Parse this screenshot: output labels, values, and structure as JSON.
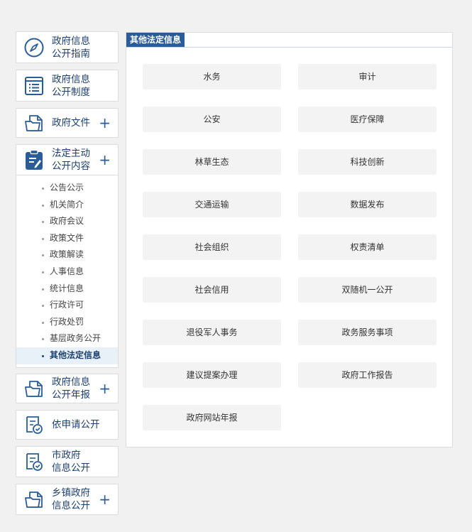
{
  "sidebar": {
    "items": [
      {
        "label": "政府信息\n公开指南",
        "icon": "compass-icon"
      },
      {
        "label": "政府信息\n公开制度",
        "icon": "document-list-icon"
      },
      {
        "label": "政府文件",
        "icon": "folder-icon",
        "plus": "+"
      },
      {
        "label": "法定主动\n公开内容",
        "icon": "clipboard-edit-icon",
        "plus": "+"
      },
      {
        "label": "政府信息\n公开年报",
        "icon": "folder-icon",
        "plus": "+"
      },
      {
        "label": "依申请公开",
        "icon": "certificate-check-icon"
      },
      {
        "label": "市政府\n信息公开",
        "icon": "certificate-check-icon"
      },
      {
        "label": "乡镇政府\n信息公开",
        "icon": "folder-icon",
        "plus": "+"
      }
    ],
    "submenu": [
      "公告公示",
      "机关简介",
      "政府会议",
      "政策文件",
      "政策解读",
      "人事信息",
      "统计信息",
      "行政许可",
      "行政处罚",
      "基层政务公开",
      "其他法定信息"
    ],
    "active_submenu": "其他法定信息"
  },
  "content": {
    "tab_title": "其他法定信息",
    "buttons": [
      "水务",
      "审计",
      "公安",
      "医疗保障",
      "林草生态",
      "科技创新",
      "交通运输",
      "数据发布",
      "社会组织",
      "权责清单",
      "社会信用",
      "双随机一公开",
      "退役军人事务",
      "政务服务事项",
      "建议提案办理",
      "政府工作报告",
      "政府网站年报"
    ]
  },
  "colors": {
    "accent": "#2a5d97",
    "nav_text": "#1d3f6e",
    "page_bg": "#f1f1f1",
    "button_bg": "#f3f3f3"
  }
}
